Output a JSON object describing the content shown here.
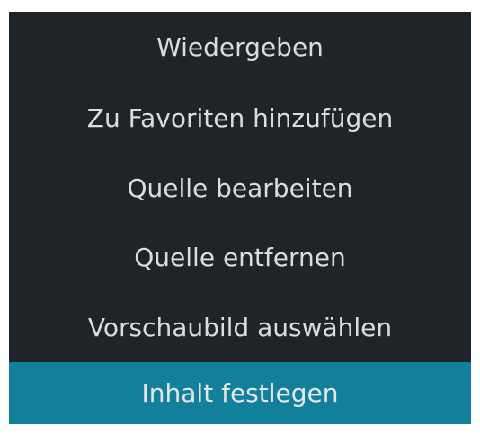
{
  "context_menu": {
    "items": [
      {
        "label": "Wiedergeben"
      },
      {
        "label": "Zu Favoriten hinzufügen"
      },
      {
        "label": "Quelle bearbeiten"
      },
      {
        "label": "Quelle entfernen"
      },
      {
        "label": "Vorschaubild auswählen"
      },
      {
        "label": "Inhalt festlegen",
        "selected": true
      }
    ],
    "colors": {
      "background": "#1e2428",
      "highlight": "#12809b",
      "text": "#dcdcdc"
    }
  }
}
